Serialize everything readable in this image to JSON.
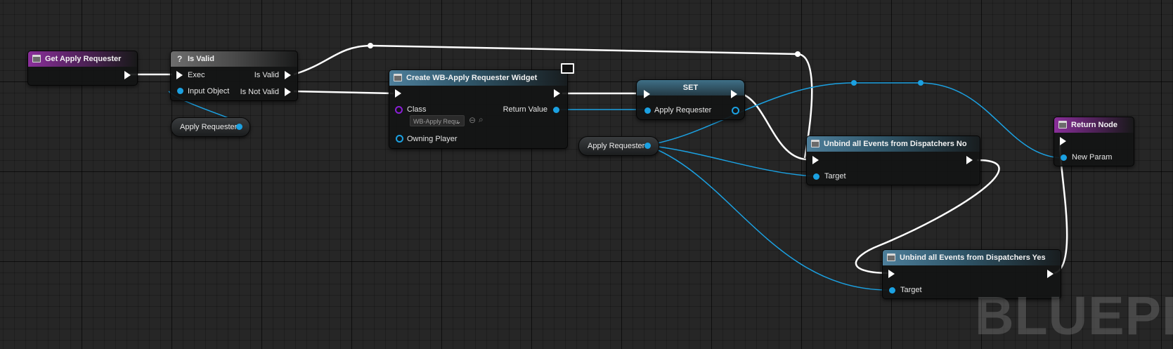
{
  "graph": {
    "watermark": "BLUEPRI"
  },
  "nodes": {
    "get_apply_requester": {
      "title": "Get Apply Requester"
    },
    "is_valid": {
      "title": "Is Valid",
      "in_exec": "Exec",
      "in_object": "Input Object",
      "out_valid": "Is Valid",
      "out_not_valid": "Is Not Valid"
    },
    "var_apply_requester_1": {
      "label": "Apply Requester"
    },
    "create_widget": {
      "title": "Create WB-Apply Requester Widget",
      "class_label": "Class",
      "class_value": "WB-Apply Requ",
      "return_value": "Return Value",
      "owning_player": "Owning Player"
    },
    "set": {
      "title": "SET",
      "pin_label": "Apply Requester"
    },
    "var_apply_requester_2": {
      "label": "Apply Requester"
    },
    "unbind_no": {
      "title": "Unbind all Events from Dispatchers No",
      "target": "Target"
    },
    "unbind_yes": {
      "title": "Unbind all Events from Dispatchers Yes",
      "target": "Target"
    },
    "return_node": {
      "title": "Return Node",
      "param": "New Param"
    }
  },
  "colors": {
    "exec_wire": "#ffffff",
    "object_wire": "#1ba1e2",
    "function_header": "#8a2f9a",
    "macro_header": "#6d6d6d",
    "widget_header": "#4d7e9a",
    "class_pin": "#8a1fd6"
  },
  "icons": {
    "function": "function-icon",
    "macro": "question-icon",
    "widget": "widget-icon",
    "context": "monitor-icon"
  }
}
